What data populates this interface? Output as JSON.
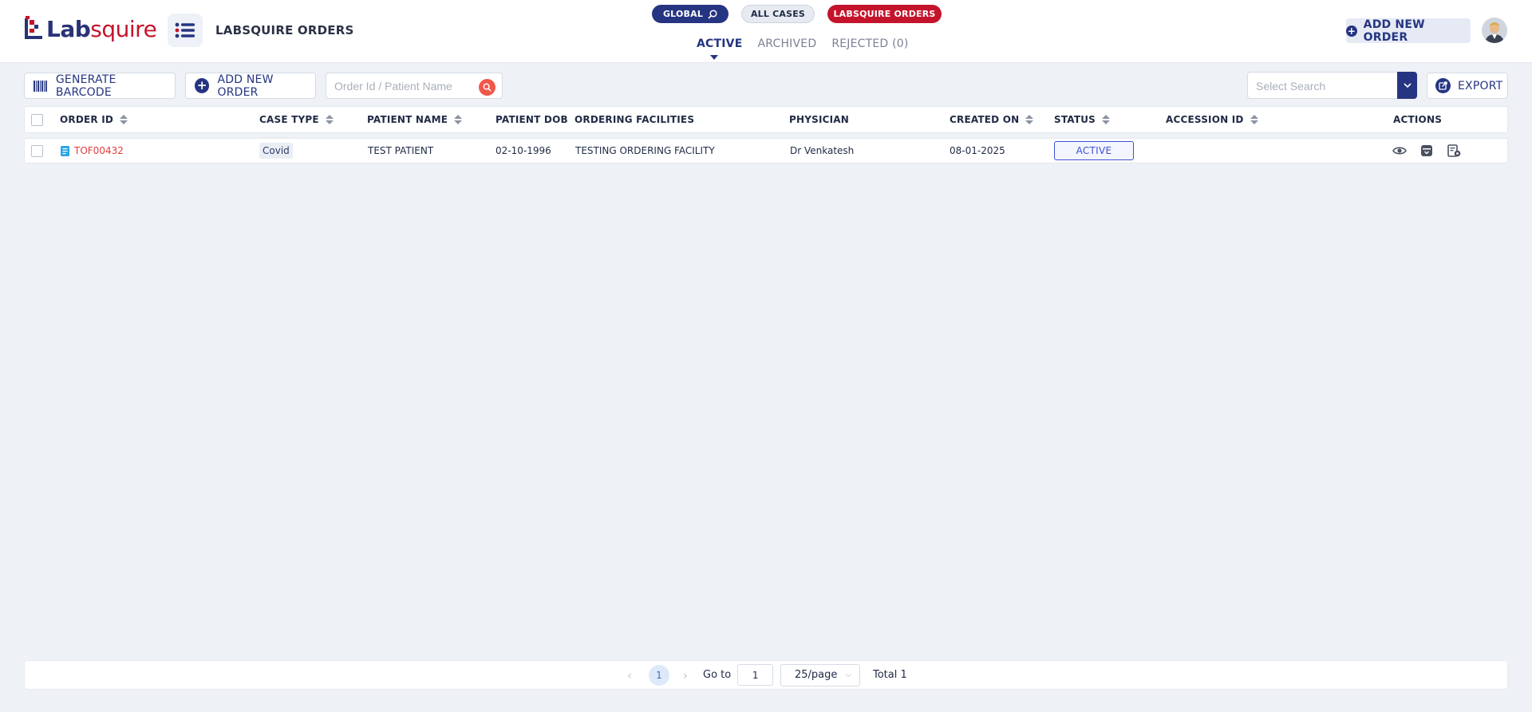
{
  "brand": {
    "lab": "Lab",
    "squire": "squire"
  },
  "header": {
    "title": "LABSQUIRE ORDERS",
    "pills": {
      "global": "GLOBAL",
      "all_cases": "ALL CASES",
      "labsquire_orders": "LABSQUIRE ORDERS"
    },
    "tabs": {
      "active": "ACTIVE",
      "archived": "ARCHIVED",
      "rejected": "REJECTED (0)"
    },
    "add_new_order": "ADD NEW ORDER"
  },
  "toolbar": {
    "generate_barcode": "GENERATE BARCODE",
    "add_new_order": "ADD NEW ORDER",
    "search_placeholder": "Order Id / Patient Name",
    "select_search_placeholder": "Select Search",
    "export": "EXPORT"
  },
  "table": {
    "headers": {
      "order_id": "ORDER ID",
      "case_type": "CASE TYPE",
      "patient_name": "PATIENT NAME",
      "patient_dob": "PATIENT DOB",
      "ordering_facilities": "ORDERING FACILITIES",
      "physician": "PHYSICIAN",
      "created_on": "CREATED ON",
      "status": "STATUS",
      "accession_id": "ACCESSION ID",
      "actions": "ACTIONS"
    },
    "rows": [
      {
        "order_id": "TOF00432",
        "case_type": "Covid",
        "patient_name": "TEST PATIENT",
        "patient_dob": "02-10-1996",
        "ordering_facility": "TESTING ORDERING FACILITY",
        "physician": "Dr Venkatesh",
        "created_on": "08-01-2025",
        "status": "ACTIVE",
        "accession_id": ""
      }
    ]
  },
  "pagination": {
    "current_page": "1",
    "goto_label": "Go to",
    "goto_value": "1",
    "page_size": "25/page",
    "total": "Total 1"
  },
  "colors": {
    "primary": "#263581",
    "brand_red": "#c4142c",
    "link_red": "#e53b3b",
    "status_blue": "#3d4fd6",
    "background": "#eef1f5"
  }
}
